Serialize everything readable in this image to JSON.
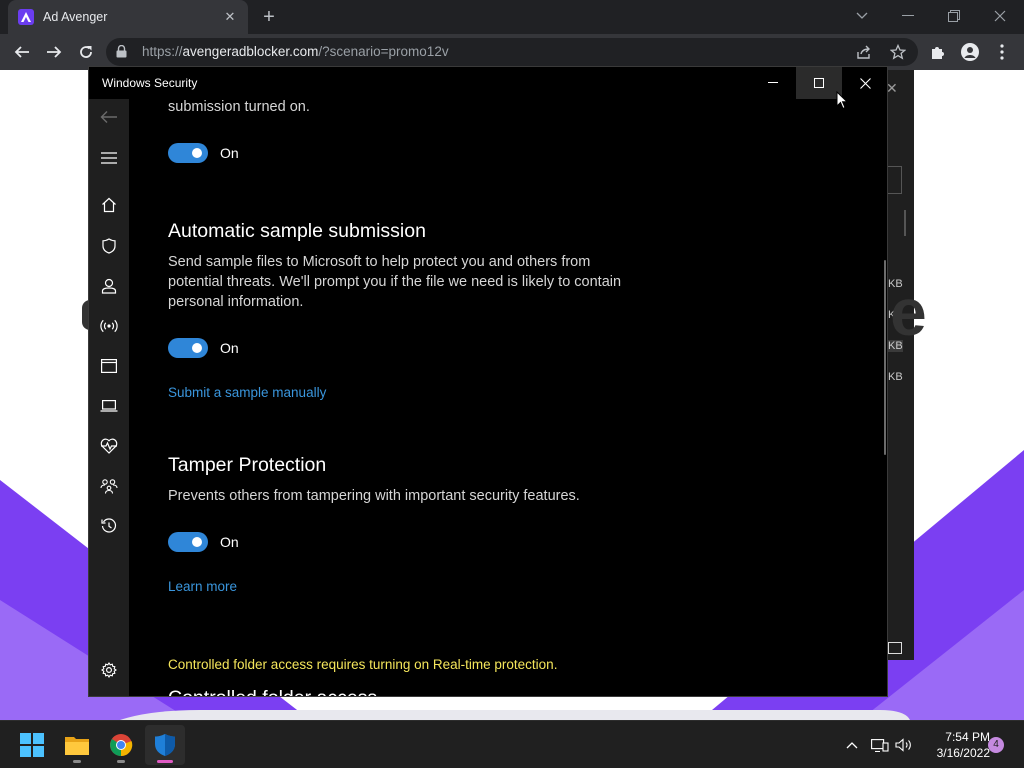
{
  "browser": {
    "tab_title": "Ad Avenger",
    "url_host": "avengeradblocker.com",
    "url_path": "/?scenario=promo12v",
    "url_scheme": "https://"
  },
  "background_page": {
    "kb_labels": [
      "KB",
      "KB",
      "KB",
      "KB"
    ],
    "big_letter": "e",
    "accent_color": "#7b3ff2"
  },
  "windows_security": {
    "title": "Windows Security",
    "sections": {
      "cloud_tail": "submission turned on.",
      "cloud_toggle": "On",
      "auto_sample_heading": "Automatic sample submission",
      "auto_sample_desc_line1": "Send sample files to Microsoft to help protect you and others from",
      "auto_sample_desc_line2": "potential threats. We'll prompt you if the file we need is likely to contain",
      "auto_sample_desc_line3": "personal information.",
      "auto_sample_toggle": "On",
      "submit_link": "Submit a sample manually",
      "tamper_heading": "Tamper Protection",
      "tamper_desc": "Prevents others from tampering with important security features.",
      "tamper_toggle": "On",
      "learn_more": "Learn more",
      "cfa_warning": "Controlled folder access requires turning on Real-time protection.",
      "cfa_heading": "Controlled folder access"
    },
    "nav_icons": [
      "back-arrow-icon",
      "hamburger-icon",
      "home-icon",
      "shield-icon",
      "account-icon",
      "firewall-network-icon",
      "app-browser-icon",
      "device-laptop-icon",
      "heart-pulse-icon",
      "family-icon",
      "history-icon",
      "settings-gear-icon"
    ],
    "toggle_color": "#2f86d8",
    "link_color": "#3a96dd",
    "warning_color": "#f5e65b"
  },
  "taskbar": {
    "time": "7:54 PM",
    "date": "3/16/2022",
    "notification_count": "4"
  }
}
